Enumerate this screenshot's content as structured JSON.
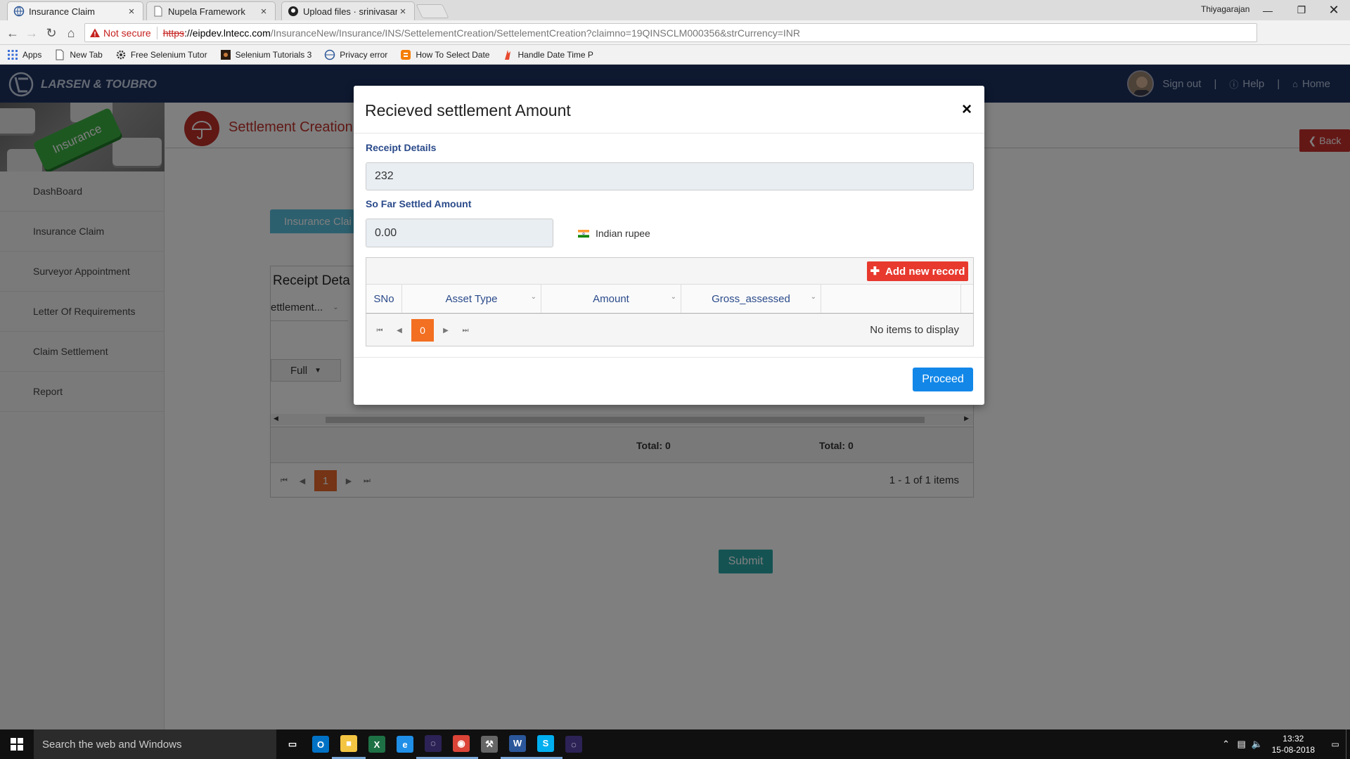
{
  "browser": {
    "tabs": [
      {
        "title": "Insurance Claim",
        "active": true,
        "icon": "globe-icon"
      },
      {
        "title": "Nupela Framework",
        "active": false,
        "icon": "page-icon"
      },
      {
        "title": "Upload files · srinivasanG",
        "active": false,
        "icon": "github-icon"
      }
    ],
    "tab_close_glyph": "×",
    "window_user": "Thiyagarajan",
    "security_label": "Not secure",
    "url_scheme": "https",
    "url_host": "://eipdev.lntecc.com",
    "url_path": "/InsuranceNew/Insurance/INS/SettelementCreation/SettelementCreation?claimno=19QINSCLM000356&strCurrency=INR",
    "bookmarks": [
      {
        "label": "Apps",
        "icon": "apps-grid-icon"
      },
      {
        "label": "New Tab",
        "icon": "page-icon"
      },
      {
        "label": "Free Selenium Tutor",
        "icon": "gear-icon"
      },
      {
        "label": "Selenium Tutorials 3",
        "icon": "dark-square-icon"
      },
      {
        "label": "Privacy error",
        "icon": "globe-icon"
      },
      {
        "label": "How To Select Date",
        "icon": "blogger-icon"
      },
      {
        "label": "Handle Date Time P",
        "icon": "flame-icon"
      }
    ]
  },
  "header": {
    "brand": "LARSEN & TOUBRO",
    "sign_out": "Sign out",
    "separator": "|",
    "help": "Help",
    "home": "Home"
  },
  "sidebar": {
    "banner_text": "Insurance",
    "items": [
      {
        "label": "DashBoard"
      },
      {
        "label": "Insurance Claim"
      },
      {
        "label": "Surveyor Appointment"
      },
      {
        "label": "Letter Of Requirements"
      },
      {
        "label": "Claim Settlement"
      },
      {
        "label": "Report"
      }
    ]
  },
  "page": {
    "title": "Settlement Creation",
    "back_label": "Back",
    "bg_tab_label": "Insurance Clai",
    "grid_title": "Receipt Deta",
    "grid_col_header": "ettlement...",
    "full_dropdown": "Full",
    "total_1": "Total: 0",
    "total_2": "Total: 0",
    "page_number": "1",
    "page_info": "1 - 1 of 1 items",
    "submit_label": "Submit"
  },
  "modal": {
    "title": "Recieved settlement Amount",
    "close_glyph": "×",
    "receipt_label": "Receipt Details",
    "receipt_value": "232",
    "settled_label": "So Far Settled Amount",
    "settled_value": "0.00",
    "currency": "Indian rupee",
    "add_record_label": "Add new record",
    "columns": [
      "SNo",
      "Asset Type",
      "Amount",
      "Gross_assessed",
      ""
    ],
    "page_number": "0",
    "no_items": "No items to display",
    "proceed_label": "Proceed"
  },
  "taskbar": {
    "search_placeholder": "Search the web and Windows",
    "time": "13:32",
    "date": "15-08-2018",
    "apps": [
      {
        "name": "task-view",
        "color": "#101010"
      },
      {
        "name": "outlook",
        "color": "#0072c6"
      },
      {
        "name": "file-explorer",
        "color": "#f4c542"
      },
      {
        "name": "excel",
        "color": "#1e7145"
      },
      {
        "name": "edge",
        "color": "#1f8fe8"
      },
      {
        "name": "eclipse",
        "color": "#2c2255"
      },
      {
        "name": "chrome",
        "color": "#db4437"
      },
      {
        "name": "tools",
        "color": "#666666"
      },
      {
        "name": "word",
        "color": "#2b579a"
      },
      {
        "name": "skype",
        "color": "#00aff0"
      },
      {
        "name": "eclipse-2",
        "color": "#2c2255"
      }
    ]
  }
}
